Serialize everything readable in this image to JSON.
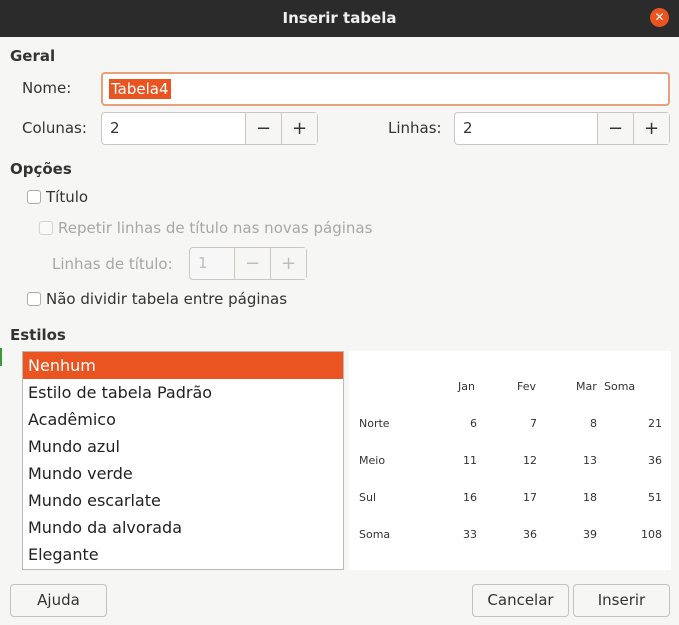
{
  "window": {
    "title": "Inserir tabela",
    "close_icon": "close-icon",
    "accent": "#e95420"
  },
  "geral": {
    "heading": "Geral",
    "name_label": "Nome:",
    "name_value": "Tabela4",
    "columns_label": "Colunas:",
    "columns_value": "2",
    "rows_label": "Linhas:",
    "rows_value": "2",
    "minus": "−",
    "plus": "+"
  },
  "opcoes": {
    "heading": "Opções",
    "titulo_label": "Título",
    "titulo_checked": false,
    "repeat_label": "Repetir linhas de título nas novas páginas",
    "repeat_checked": false,
    "heading_rows_label": "Linhas de título:",
    "heading_rows_value": "1",
    "no_split_label": "Não dividir tabela entre páginas",
    "no_split_checked": false
  },
  "estilos": {
    "heading": "Estilos",
    "items": [
      "Nenhum",
      "Estilo de tabela Padrão",
      "Acadêmico",
      "Mundo azul",
      "Mundo verde",
      "Mundo escarlate",
      "Mundo da alvorada",
      "Elegante"
    ],
    "selected": "Nenhum"
  },
  "preview": {
    "header": [
      "",
      "Jan",
      "Fev",
      "Mar",
      "Soma"
    ],
    "rows": [
      [
        "Norte",
        "6",
        "7",
        "8",
        "21"
      ],
      [
        "Meio",
        "11",
        "12",
        "13",
        "36"
      ],
      [
        "Sul",
        "16",
        "17",
        "18",
        "51"
      ],
      [
        "Soma",
        "33",
        "36",
        "39",
        "108"
      ]
    ]
  },
  "buttons": {
    "help": "Ajuda",
    "cancel": "Cancelar",
    "insert": "Inserir"
  }
}
